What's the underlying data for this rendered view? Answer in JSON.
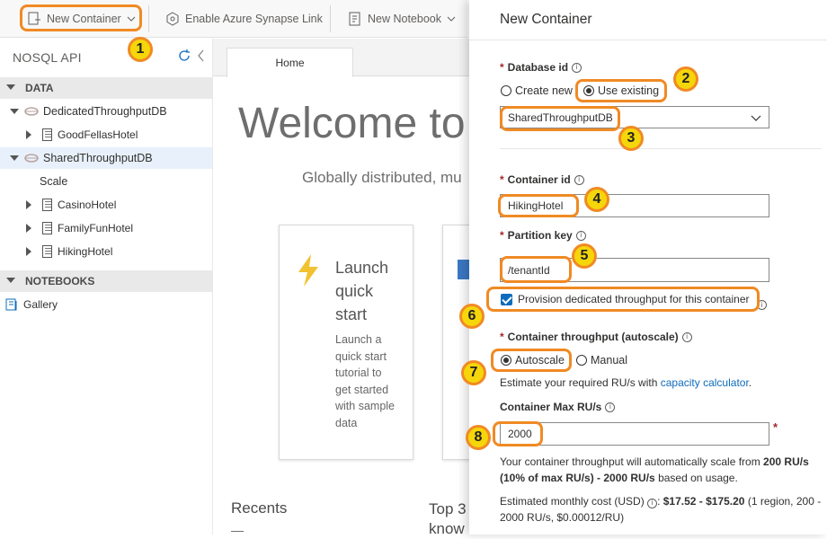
{
  "toolbar": {
    "new_container": "New Container",
    "synapse": "Enable Azure Synapse Link",
    "new_notebook": "New Notebook"
  },
  "tree": {
    "api_title": "NOSQL API",
    "data_section": "DATA",
    "db1": "DedicatedThroughputDB",
    "db1_child": "GoodFellasHotel",
    "db2": "SharedThroughputDB",
    "scale": "Scale",
    "containers": [
      "CasinoHotel",
      "FamilyFunHotel",
      "HikingHotel"
    ],
    "notebooks_section": "NOTEBOOKS",
    "gallery": "Gallery"
  },
  "main": {
    "tab_home": "Home",
    "welcome": "Welcome to",
    "subtitle": "Globally distributed, mu",
    "card": {
      "title_1": "Launch",
      "title_2": "quick",
      "title_3": "start",
      "desc_1": "Launch a",
      "desc_2": "quick start",
      "desc_3": "tutorial to",
      "desc_4": "get started",
      "desc_5": "with sample",
      "desc_6": "data"
    },
    "recents": "Recents",
    "recents_dash": "—",
    "top3_1": "Top 3",
    "top3_2": "know"
  },
  "panel": {
    "title": "New Container",
    "database_id_label": "Database id",
    "create_new": "Create new",
    "use_existing": "Use existing",
    "database_value": "SharedThroughputDB",
    "container_id_label": "Container id",
    "container_id_value": "HikingHotel",
    "partition_key_label": "Partition key",
    "partition_key_value": "/tenantId",
    "provision_label": "Provision dedicated throughput for this container",
    "throughput_label": "Container throughput (autoscale)",
    "autoscale": "Autoscale",
    "manual": "Manual",
    "estimate_text": "Estimate your required RU/s with ",
    "capacity_link": "capacity calculator",
    "estimate_end": ".",
    "max_ru_label": "Container Max RU/s",
    "max_ru_value": "2000",
    "auto_scale_desc_1": "Your container throughput will automatically scale from ",
    "auto_scale_bold_1": "200 RU/s",
    "auto_scale_bold_2": "(10% of max RU/s) - 2000 RU/s",
    "auto_scale_desc_2": " based on usage.",
    "cost_label": "Estimated monthly cost (USD)",
    "cost_range": "$17.52 - $175.20",
    "cost_detail_1": " (1 region, 200 -",
    "cost_detail_2": "2000 RU/s, $0.00012/RU)",
    "required_mark": "*"
  },
  "badges": [
    "1",
    "2",
    "3",
    "4",
    "5",
    "6",
    "7",
    "8"
  ],
  "colors": {
    "highlight": "#f08a24",
    "badge": "#f5d60a",
    "link": "#0f6cbd",
    "required": "#a4262c"
  }
}
